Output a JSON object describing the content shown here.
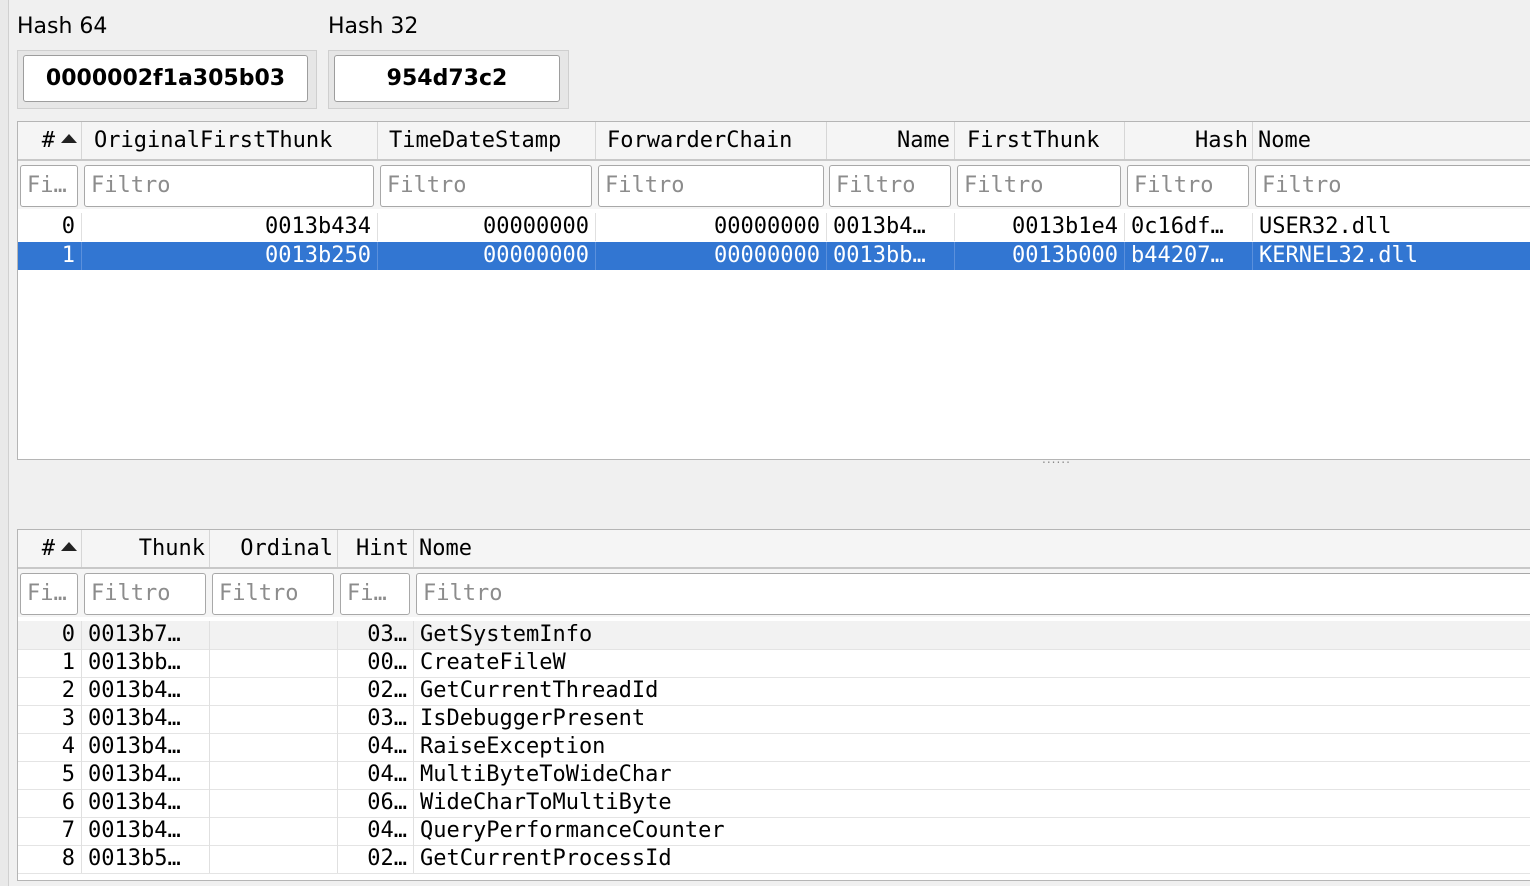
{
  "hash64": {
    "label": "Hash 64",
    "value": "0000002f1a305b03"
  },
  "hash32": {
    "label": "Hash 32",
    "value": "954d73c2"
  },
  "imports_table": {
    "headers": [
      "#",
      "OriginalFirstThunk",
      "TimeDateStamp",
      "ForwarderChain",
      "Name",
      "FirstThunk",
      "Hash",
      "Nome"
    ],
    "filters": [
      "Fi…",
      "Filtro",
      "Filtro",
      "Filtro",
      "Filtro",
      "Filtro",
      "Filtro",
      "Filtro"
    ],
    "rows": [
      [
        "0",
        "0013b434",
        "00000000",
        "00000000",
        "0013b4…",
        "0013b1e4",
        "0c16df…",
        "USER32.dll"
      ],
      [
        "1",
        "0013b250",
        "00000000",
        "00000000",
        "0013bb…",
        "0013b000",
        "b44207…",
        "KERNEL32.dll"
      ]
    ],
    "selected_row": 1
  },
  "functions_table": {
    "headers": [
      "#",
      "Thunk",
      "Ordinal",
      "Hint",
      "Nome"
    ],
    "filters": [
      "Fi…",
      "Filtro",
      "Filtro",
      "Fi…",
      "Filtro"
    ],
    "rows": [
      [
        "0",
        "0013b7…",
        "",
        "03…",
        "GetSystemInfo"
      ],
      [
        "1",
        "0013bb…",
        "",
        "00…",
        "CreateFileW"
      ],
      [
        "2",
        "0013b4…",
        "",
        "02…",
        "GetCurrentThreadId"
      ],
      [
        "3",
        "0013b4…",
        "",
        "03…",
        "IsDebuggerPresent"
      ],
      [
        "4",
        "0013b4…",
        "",
        "04…",
        "RaiseException"
      ],
      [
        "5",
        "0013b4…",
        "",
        "04…",
        "MultiByteToWideChar"
      ],
      [
        "6",
        "0013b4…",
        "",
        "06…",
        "WideCharToMultiByte"
      ],
      [
        "7",
        "0013b4…",
        "",
        "04…",
        "QueryPerformanceCounter"
      ],
      [
        "8",
        "0013b5…",
        "",
        "02…",
        "GetCurrentProcessId"
      ]
    ]
  },
  "splitter_glyph": "......"
}
